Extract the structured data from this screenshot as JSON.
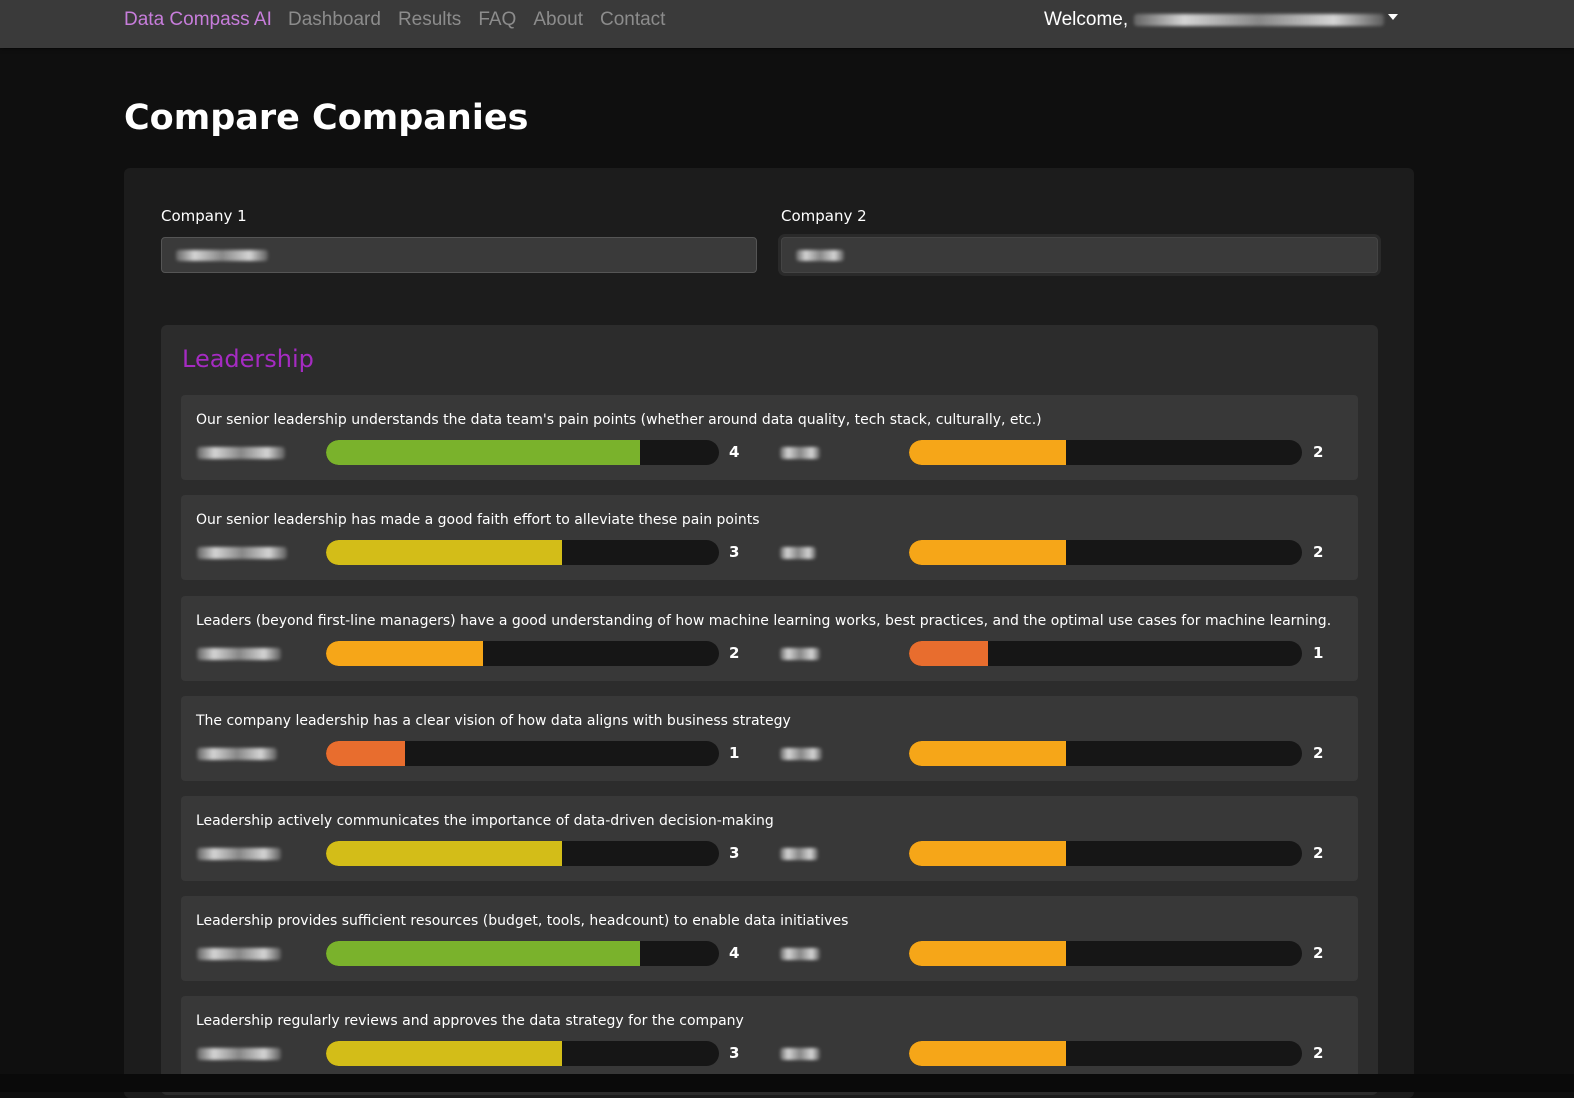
{
  "nav": {
    "brand": "Data Compass AI",
    "links": [
      "Dashboard",
      "Results",
      "FAQ",
      "About",
      "Contact"
    ],
    "welcome": "Welcome,"
  },
  "page": {
    "title": "Compare Companies"
  },
  "form": {
    "company1_label": "Company 1",
    "company2_label": "Company 2"
  },
  "section": {
    "title": "Leadership",
    "max_score": 5,
    "colors": {
      "1": "#e86d2e",
      "2": "#f6a618",
      "3": "#d3bd18",
      "4": "#7ab22c",
      "5": "#3fa34d"
    },
    "questions": [
      {
        "text": "Our senior leadership understands the data team's pain points (whether around data quality, tech stack, culturally, etc.)",
        "score1": 4,
        "score2": 2
      },
      {
        "text": "Our senior leadership has made a good faith effort to alleviate these pain points",
        "score1": 3,
        "score2": 2
      },
      {
        "text": "Leaders (beyond first-line managers) have a good understanding of how machine learning works, best practices, and the optimal use cases for machine learning.",
        "score1": 2,
        "score2": 1
      },
      {
        "text": "The company leadership has a clear vision of how data aligns with business strategy",
        "score1": 1,
        "score2": 2
      },
      {
        "text": "Leadership actively communicates the importance of data-driven decision-making",
        "score1": 3,
        "score2": 2
      },
      {
        "text": "Leadership provides sufficient resources (budget, tools, headcount) to enable data initiatives",
        "score1": 4,
        "score2": 2
      },
      {
        "text": "Leadership regularly reviews and approves the data strategy for the company",
        "score1": 3,
        "score2": 2
      }
    ]
  }
}
